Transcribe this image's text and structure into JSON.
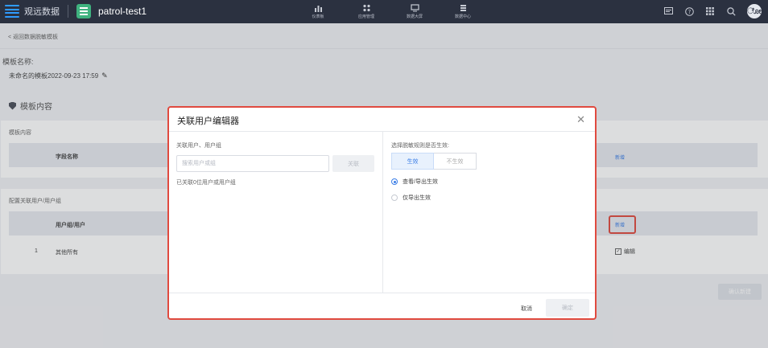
{
  "topbar": {
    "brand": "观远数据",
    "app_name": "patrol-test1",
    "nav": [
      {
        "label": "仪表板",
        "icon": "bar-chart-icon"
      },
      {
        "label": "应用管理",
        "icon": "grid-apps-icon"
      },
      {
        "label": "数据大屏",
        "icon": "screen-icon"
      },
      {
        "label": "数据中心",
        "icon": "data-center-icon"
      }
    ],
    "right_icons": [
      "message-icon",
      "help-icon",
      "apps-icon",
      "search-icon",
      "avatar"
    ],
    "avatar_text": "ೋ"
  },
  "breadcrumb": "< 返回数据脱敏模板",
  "template": {
    "label": "模板名称:",
    "name": "未命名的模板2022-09-23 17:59"
  },
  "section": {
    "title": "模板内容"
  },
  "content_card": {
    "title": "模板内容",
    "col_field": "字段名称",
    "add": "新增"
  },
  "users_card": {
    "title": "配置关联用户/用户组",
    "col_user": "用户组/用户",
    "add": "新增",
    "row_index": "1",
    "row_name": "其他所有",
    "row_edit": "编辑"
  },
  "confirm_create": "确认新建",
  "modal": {
    "title": "关联用户编辑器",
    "left_label": "关联用户、用户组",
    "search_placeholder": "搜索用户或组",
    "link_btn": "关联",
    "linked_count": "已关联0位用户或用户组",
    "right_label": "选择脱敏规则是否生效:",
    "seg_on": "生效",
    "seg_off": "不生效",
    "radio_view_export": "查看/导出生效",
    "radio_export_only": "仅导出生效",
    "cancel": "取消",
    "ok": "确定"
  },
  "colors": {
    "accent": "#3a7de6",
    "highlight": "#e04a3f",
    "topbar": "#2b3140"
  }
}
